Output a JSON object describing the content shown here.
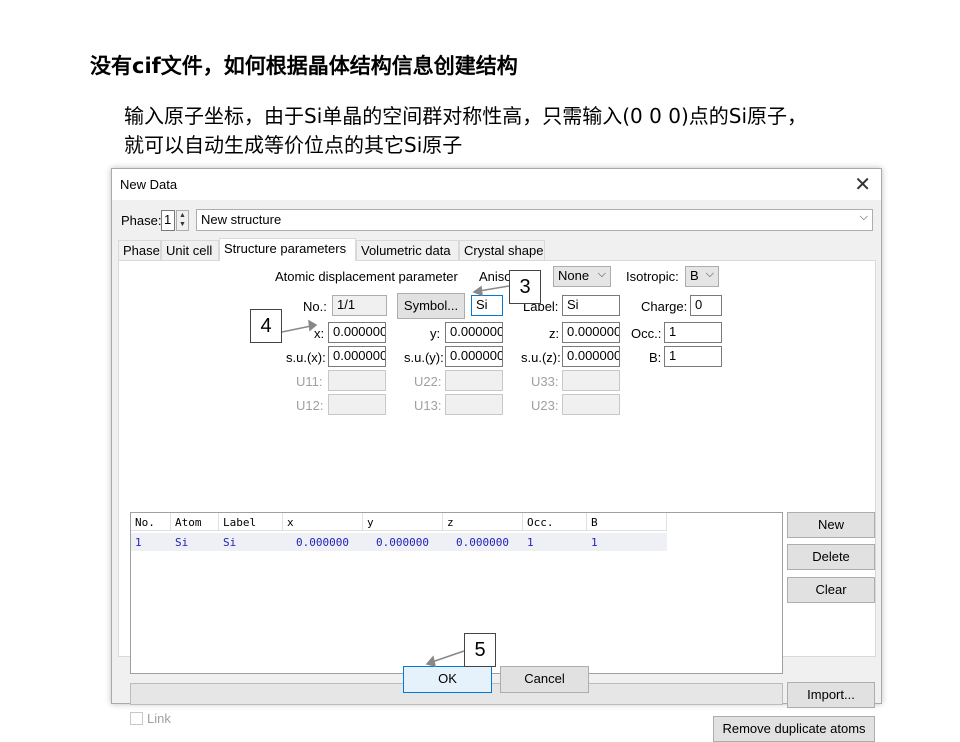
{
  "slide": {
    "title": "没有cif文件，如何根据晶体结构信息创建结构",
    "body_line1": "输入原子坐标，由于Si单晶的空间群对称性高，只需输入(0 0 0)点的Si原子，",
    "body_line2": "就可以自动生成等价位点的其它Si原子"
  },
  "dialog": {
    "title": "New Data",
    "close_glyph": "✕",
    "phase_label": "Phase:",
    "phase_value": "1",
    "phase_name": "New structure",
    "tabs": [
      "Phase",
      "Unit cell",
      "Structure parameters",
      "Volumetric data",
      "Crystal shape"
    ],
    "active_tab": "Structure parameters",
    "params": {
      "adp_label": "Atomic displacement parameter",
      "aniso_label": "Aniso..ic:",
      "aniso_value": "None",
      "isotropic_label": "Isotropic:",
      "isotropic_value": "B",
      "no_label": "No.:",
      "no_value": "1/1",
      "symbol_button": "Symbol...",
      "symbol_value": "Si",
      "label_label": "Label:",
      "label_value": "Si",
      "charge_label": "Charge:",
      "charge_value": "0",
      "x_label": "x:",
      "x_value": "0.000000",
      "y_label": "y:",
      "y_value": "0.000000",
      "z_label": "z:",
      "z_value": "0.000000",
      "occ_label": "Occ.:",
      "occ_value": "1",
      "sux_label": "s.u.(x):",
      "sux_value": "0.000000",
      "suy_label": "s.u.(y):",
      "suy_value": "0.000000",
      "suz_label": "s.u.(z):",
      "suz_value": "0.000000",
      "b_label": "B:",
      "b_value": "1",
      "u11_label": "U11:",
      "u22_label": "U22:",
      "u33_label": "U33:",
      "u12_label": "U12:",
      "u13_label": "U13:",
      "u23_label": "U23:"
    },
    "table": {
      "headers": [
        "No.",
        "Atom",
        "Label",
        "x",
        "y",
        "z",
        "Occ.",
        "B"
      ],
      "rows": [
        [
          "1",
          "Si",
          "Si",
          "0.000000",
          "0.000000",
          "0.000000",
          "1",
          "1"
        ]
      ]
    },
    "buttons": {
      "new": "New",
      "delete": "Delete",
      "clear": "Clear",
      "import": "Import...",
      "remove_duplicates": "Remove duplicate atoms",
      "ok": "OK",
      "cancel": "Cancel"
    },
    "link_label": "Link"
  },
  "callouts": [
    "3",
    "4",
    "5"
  ]
}
